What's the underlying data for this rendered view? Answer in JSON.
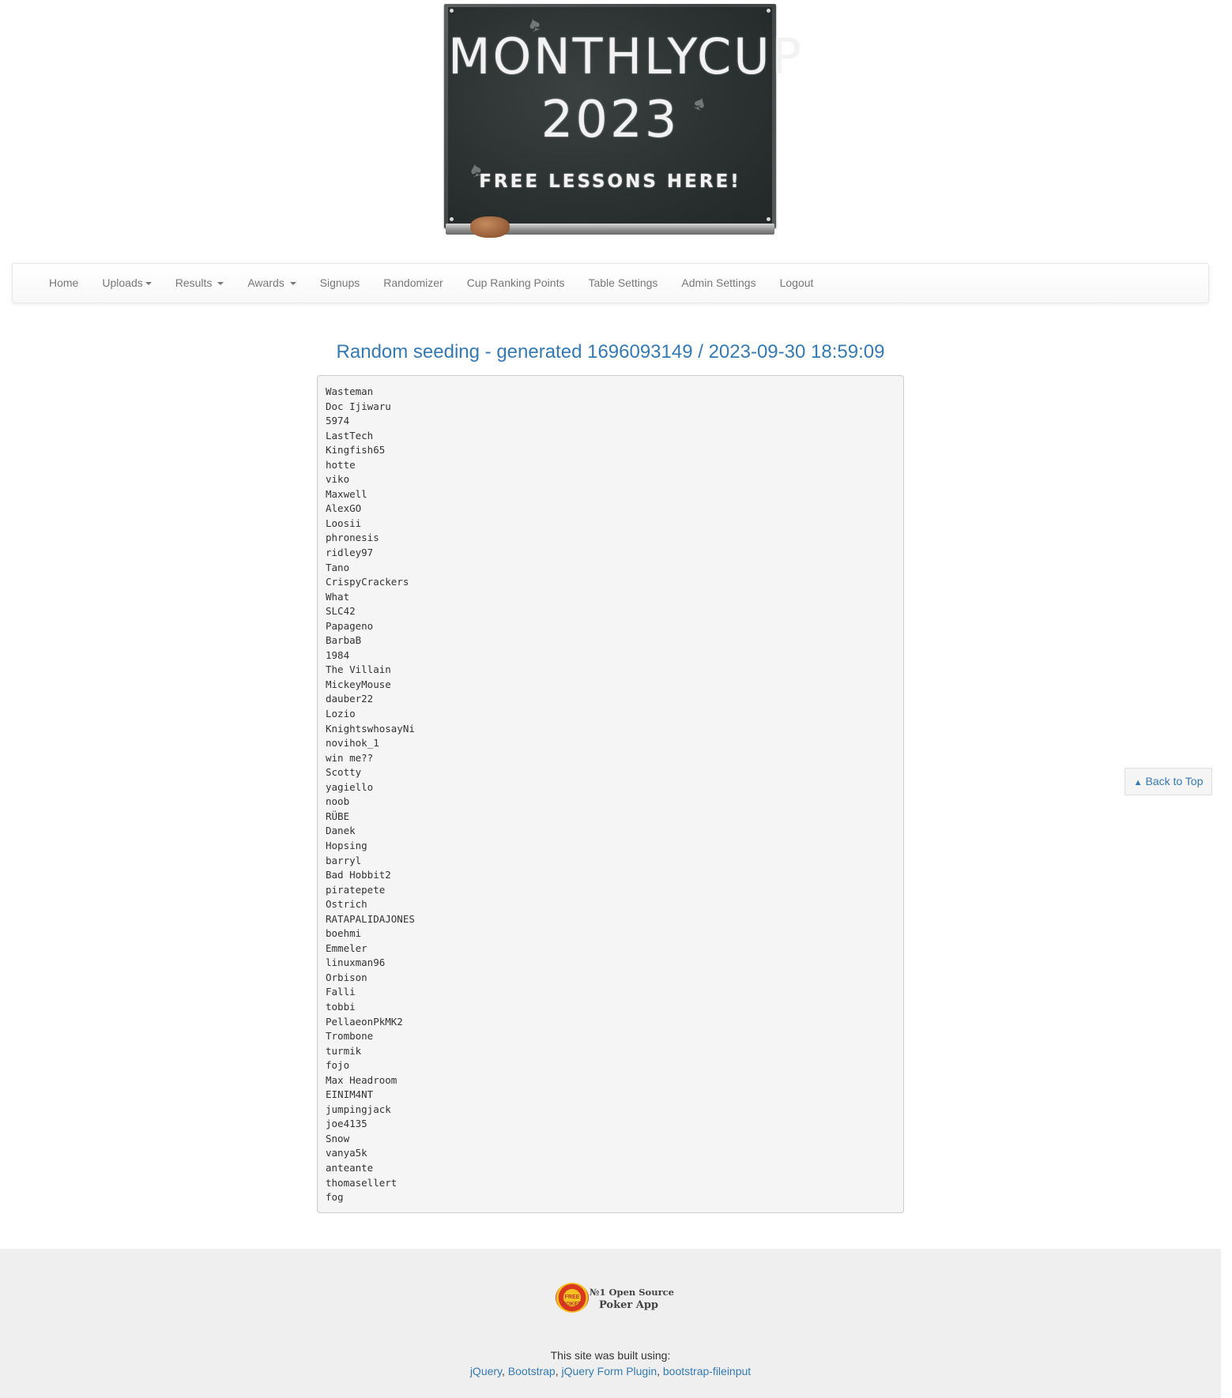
{
  "banner": {
    "line1": "MONTHLYCUP",
    "line2": "2023",
    "line3": "FREE LESSONS HERE!",
    "icons": [
      "spade-icon",
      "spade-icon",
      "spade-icon"
    ]
  },
  "nav": {
    "home": "Home",
    "uploads": "Uploads",
    "results": "Results",
    "awards": "Awards",
    "signups": "Signups",
    "randomizer": "Randomizer",
    "cup_ranking_points": "Cup Ranking Points",
    "table_settings": "Table Settings",
    "admin_settings": "Admin Settings",
    "logout": "Logout"
  },
  "main": {
    "heading": "Random seeding - generated 1696093149 / 2023-09-30 18:59:09",
    "players": [
      "Wasteman",
      "Doc Ijiwaru",
      "5974",
      "LastTech",
      "Kingfish65",
      "hotte",
      "viko",
      "Maxwell",
      "AlexGO",
      "Loosii",
      "phronesis",
      "ridley97",
      "Tano",
      "CrispyCrackers",
      "What",
      "SLC42",
      "Papageno",
      "BarbaB",
      "1984",
      "The Villain",
      "MickeyMouse",
      "dauber22",
      "Lozio",
      "KnightswhosayNi",
      "novihok_1",
      "win me??",
      "Scotty",
      "yagiello",
      "noob",
      "RÜBE",
      "Danek",
      "Hopsing",
      "barryl",
      "Bad Hobbit2",
      "piratepete",
      "Ostrich",
      "RATAPALIDAJONES",
      "boehmi",
      "Emmeler",
      "linuxman96",
      "Orbison",
      "Falli",
      "tobbi",
      "PellaeonPkMK2",
      "Trombone",
      "turmik",
      "fojo",
      "Max Headroom",
      "EINIM4NT",
      "jumpingjack",
      "joe4135",
      "Snow",
      "vanya5k",
      "anteante",
      "thomasellert",
      "fog"
    ]
  },
  "back_to_top": {
    "label": "Back to Top",
    "icon": "chevron-up-icon"
  },
  "footer": {
    "logo_line1": "№1 Open Source",
    "logo_line2": "Poker App",
    "chip_text": "FREE POKER",
    "built_using": "This site was built using:",
    "links": [
      "jQuery",
      "Bootstrap",
      "jQuery Form Plugin",
      "bootstrap-fileinput"
    ],
    "separator": ", "
  },
  "colors": {
    "link": "#337ab7",
    "nav_text": "#777777",
    "pre_bg": "#f5f5f5",
    "footer_bg": "#efefef",
    "board": "#2b3231"
  }
}
